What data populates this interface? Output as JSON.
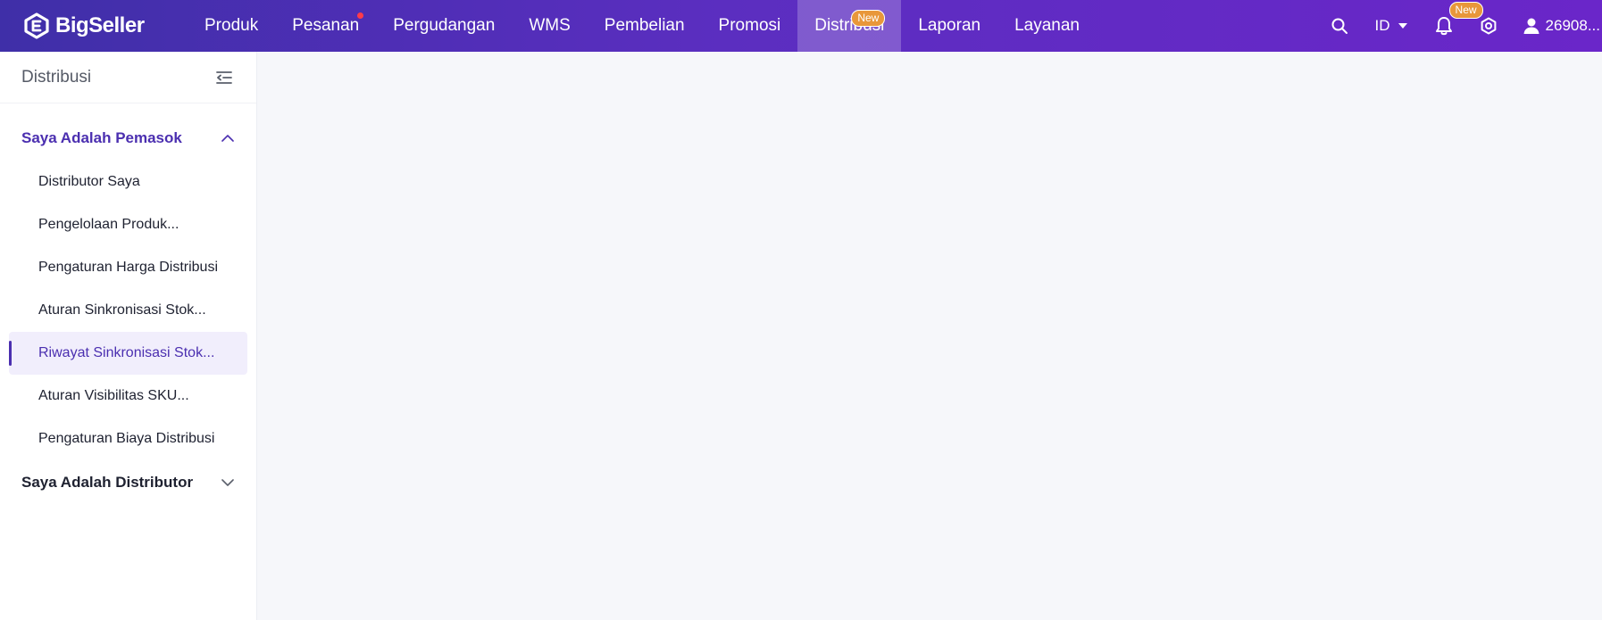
{
  "brand": {
    "name": "BigSeller"
  },
  "nav": {
    "items": [
      {
        "label": "Produk"
      },
      {
        "label": "Pesanan"
      },
      {
        "label": "Pergudangan"
      },
      {
        "label": "WMS"
      },
      {
        "label": "Pembelian"
      },
      {
        "label": "Promosi"
      },
      {
        "label": "Distribusi",
        "badge": "New",
        "active": true
      },
      {
        "label": "Laporan"
      },
      {
        "label": "Layanan"
      }
    ]
  },
  "toolbar": {
    "language": "ID",
    "notification_badge": "New",
    "user": "26908..."
  },
  "sidebar": {
    "title": "Distribusi",
    "groups": [
      {
        "label": "Saya Adalah Pemasok",
        "expanded": true,
        "items": [
          {
            "label": "Distributor Saya"
          },
          {
            "label": "Pengelolaan Produk..."
          },
          {
            "label": "Pengaturan Harga Distribusi"
          },
          {
            "label": "Aturan Sinkronisasi Stok..."
          },
          {
            "label": "Riwayat Sinkronisasi Stok...",
            "active": true
          },
          {
            "label": "Aturan Visibilitas SKU..."
          },
          {
            "label": "Pengaturan Biaya Distribusi"
          }
        ]
      },
      {
        "label": "Saya Adalah Distributor",
        "expanded": false
      }
    ]
  },
  "colors": {
    "accent": "#4b2fb0",
    "topbar_start": "#3f2fa8",
    "topbar_end": "#6a26c9",
    "badge": "#e8973a",
    "alert_dot": "#ff3b4a"
  },
  "icons": {
    "logo": "bigseller-logo-icon",
    "search": "search-icon",
    "language_dropdown": "caret-down-icon",
    "bell": "bell-icon",
    "settings": "gear-icon",
    "user": "user-icon",
    "collapse": "collapse-menu-icon",
    "expand_open": "chevron-up-icon",
    "expand_closed": "chevron-down-icon"
  }
}
